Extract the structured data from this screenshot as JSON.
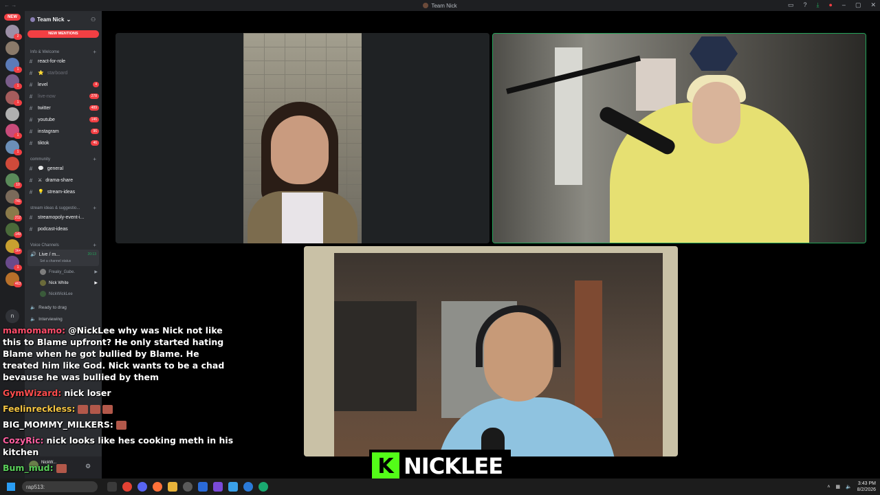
{
  "window": {
    "title": "Team Nick"
  },
  "rail": {
    "new_label": "NEW",
    "servers": [
      {
        "badge": "2",
        "color": "#9c8fa6"
      },
      {
        "badge": "",
        "color": "#8a7a6a"
      },
      {
        "badge": "1",
        "color": "#5b7bb8"
      },
      {
        "badge": "1",
        "color": "#7a5d8a"
      },
      {
        "badge": "1",
        "color": "#a55c5c"
      },
      {
        "badge": "",
        "color": "#b0b0b0"
      },
      {
        "badge": "1",
        "color": "#c84b7a"
      },
      {
        "badge": "1",
        "color": "#6b8fb8"
      },
      {
        "badge": "",
        "color": "#d04a3a"
      },
      {
        "badge": "10",
        "color": "#5a8a5a"
      },
      {
        "badge": "741",
        "color": "#7a6a5a"
      },
      {
        "badge": "212",
        "color": "#8a7a4a"
      },
      {
        "badge": "149",
        "color": "#4a6a3a"
      },
      {
        "badge": "1k+",
        "color": "#c8a030"
      },
      {
        "badge": "1",
        "color": "#6a4a8a"
      },
      {
        "badge": "463",
        "color": "#b8702a"
      }
    ],
    "bottom_label": "n"
  },
  "sidebar": {
    "server_name": "Team Nick",
    "new_mentions": "NEW MENTIONS",
    "categories": {
      "info": "Info & Welcome",
      "community": "community",
      "stream": "stream ideas & suggestio...",
      "voice": "Voice Channels"
    },
    "channels": [
      {
        "name": "react-for-role",
        "count": "",
        "muted": false,
        "emoji": ""
      },
      {
        "name": "starboard",
        "count": "",
        "muted": true,
        "emoji": "⭐"
      },
      {
        "name": "level",
        "count": "4",
        "muted": false,
        "emoji": ""
      },
      {
        "name": "live-now",
        "count": "278",
        "muted": true,
        "emoji": ""
      },
      {
        "name": "twitter",
        "count": "489",
        "muted": false,
        "emoji": ""
      },
      {
        "name": "youtube",
        "count": "146",
        "muted": false,
        "emoji": ""
      },
      {
        "name": "instagram",
        "count": "96",
        "muted": false,
        "emoji": ""
      },
      {
        "name": "tiktok",
        "count": "46",
        "muted": false,
        "emoji": ""
      },
      {
        "name": "general",
        "count": "",
        "muted": false,
        "emoji": "💬"
      },
      {
        "name": "drama-share",
        "count": "",
        "muted": false,
        "emoji": "⚔"
      },
      {
        "name": "stream-ideas",
        "count": "",
        "muted": false,
        "emoji": "💡"
      },
      {
        "name": "streamopoly-event-i...",
        "count": "",
        "muted": false,
        "emoji": ""
      },
      {
        "name": "podcast-ideas",
        "count": "",
        "muted": false,
        "emoji": ""
      }
    ],
    "voice": {
      "name": "Live / m...",
      "timer": "20:13",
      "status": "Set a channel status",
      "users": [
        "Freaky_Gabe.",
        "Nick White",
        "NickWickLee"
      ]
    },
    "misc": [
      "Ready to drag",
      "Interviewing"
    ],
    "userpanel_name": "NickW..."
  },
  "stage": {
    "name_badge_letter": "K",
    "name_badge_text": "NICKLEE"
  },
  "chat": [
    {
      "user": "mamomamo:",
      "color": "#ff4d6a",
      "text": "@NickLee why was Nick not like this to Blame upfront? He only started hating Blame when he got bullied by Blame. He treated him like God. Nick wants to be a chad bevause he was bullied by them"
    },
    {
      "user": "GymWizard:",
      "color": "#ff4d4d",
      "text": "nick loser"
    },
    {
      "user": "Feelinreckless:",
      "color": "#f5c542",
      "text": "",
      "emotes": 3
    },
    {
      "user": "BIG_MOMMY_MILKERS:",
      "color": "#ffffff",
      "text": "",
      "emotes": 1
    },
    {
      "user": "CozyRic:",
      "color": "#ff5fa0",
      "text": "nick looks like hes cooking meth in his kitchen"
    },
    {
      "user": "Bum_mud:",
      "color": "#5ad05a",
      "text": "",
      "emotes": 1
    }
  ],
  "taskbar": {
    "search_text": "rap513:",
    "time": "3:43 PM",
    "date": "8/2/2026"
  }
}
